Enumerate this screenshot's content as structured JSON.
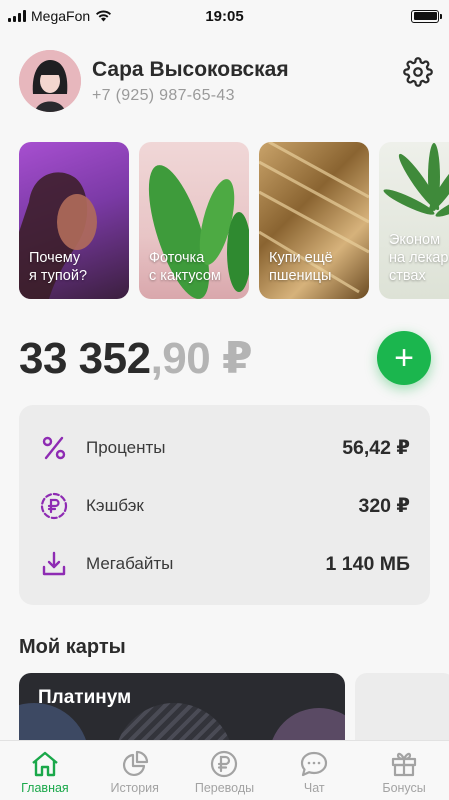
{
  "status_bar": {
    "carrier": "MegaFon",
    "time": "19:05",
    "icons": [
      "signal-icon",
      "wifi-icon",
      "battery-icon"
    ],
    "battery_level": 1.0
  },
  "profile": {
    "name": "Сара Высоковская",
    "phone": "+7 (925) 987-65-43",
    "settings_icon": "gear-icon"
  },
  "stories": [
    {
      "label": "Почему\nя тупой?"
    },
    {
      "label": "Фоточка\nс кактусом"
    },
    {
      "label": "Купи ещё\nпшеницы"
    },
    {
      "label": "Эконом\nна лекар\nствах"
    }
  ],
  "balance": {
    "integer": "33 352",
    "fraction": ",90 ₽",
    "add_label": "+"
  },
  "bonuses": [
    {
      "icon": "percent-icon",
      "label": "Проценты",
      "value": "56,42 ₽"
    },
    {
      "icon": "ruble-coin-icon",
      "label": "Кэшбэк",
      "value": "320 ₽"
    },
    {
      "icon": "download-icon",
      "label": "Мегабайты",
      "value": "1 140 МБ"
    }
  ],
  "cards": {
    "title": "Мой карты",
    "items": [
      {
        "name": "Платинум"
      }
    ]
  },
  "tab_bar": [
    {
      "label": "Главная",
      "icon": "home-icon",
      "active": true
    },
    {
      "label": "История",
      "icon": "pie-chart-icon",
      "active": false
    },
    {
      "label": "Переводы",
      "icon": "ruble-icon",
      "active": false
    },
    {
      "label": "Чат",
      "icon": "chat-bubble-icon",
      "active": false
    },
    {
      "label": "Бонусы",
      "icon": "gift-icon",
      "active": false
    }
  ],
  "colors": {
    "accent_green": "#1bb64e",
    "bonus_purple": "#8e2bb3",
    "text_dark": "#2b2b2b",
    "text_muted": "#9a9a9a"
  }
}
